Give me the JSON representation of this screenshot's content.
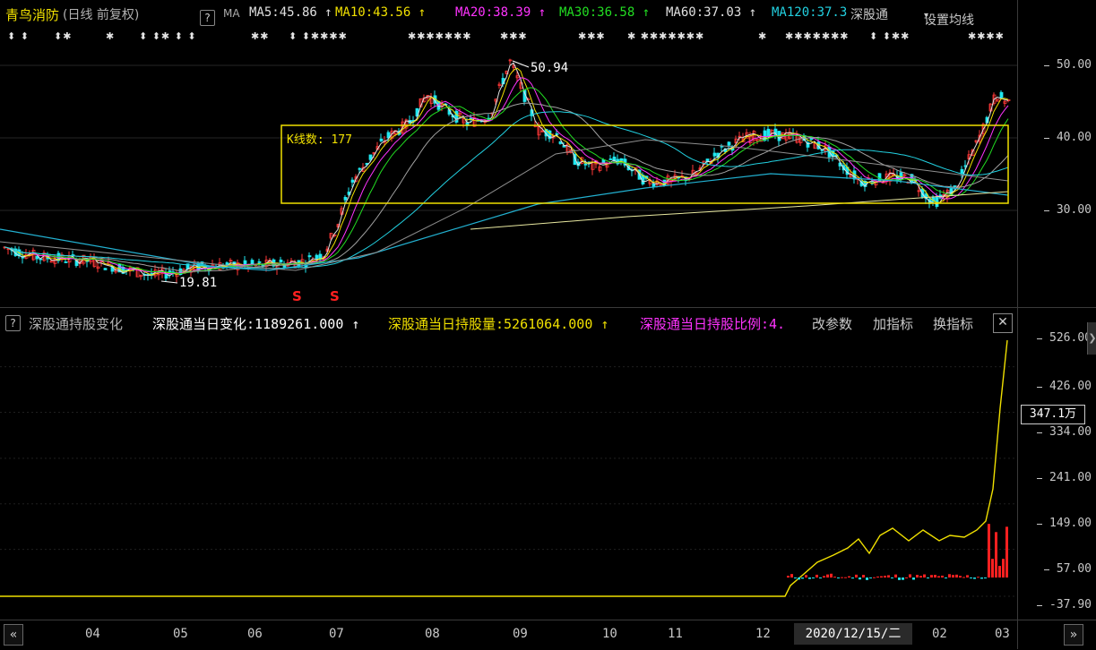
{
  "header": {
    "stock_name": "青鸟消防",
    "period_info": "(日线 前复权)",
    "help_glyph": "?",
    "ma_label": "MA",
    "ma_items": [
      {
        "text": "MA5:45.86",
        "arrow": "↑",
        "color": "#e0e0e0"
      },
      {
        "text": "MA10:43.56",
        "arrow": "↑",
        "color": "#f0e000"
      },
      {
        "text": "MA20:38.39",
        "arrow": "↑",
        "color": "#ff33ff"
      },
      {
        "text": "MA30:36.58",
        "arrow": "↑",
        "color": "#22dd22"
      },
      {
        "text": "MA60:37.03",
        "arrow": "↑",
        "color": "#e0e0e0"
      },
      {
        "text": "MA120:37.3",
        "arrow": "",
        "color": "#22d0e0"
      }
    ],
    "hk_connect": "深股通",
    "set_ma": "设置均线"
  },
  "markers": [
    {
      "text": "⬍ ⬍"
    },
    {
      "text": "⬍✱"
    },
    {
      "text": "✱"
    },
    {
      "text": "⬍ ⬍✱ ⬍ ⬍"
    },
    {
      "text": "✱✱"
    },
    {
      "text": "⬍ ⬍✱✱✱✱"
    },
    {
      "text": "✱✱✱✱✱✱✱"
    },
    {
      "text": "✱✱✱"
    },
    {
      "text": "✱✱✱"
    },
    {
      "text": "✱ ✱✱✱✱✱✱✱"
    },
    {
      "text": "✱"
    },
    {
      "text": "✱✱✱✱✱✱✱"
    },
    {
      "text": "⬍ ⬍✱✱"
    },
    {
      "text": "✱✱✱✱"
    }
  ],
  "price_chart": {
    "high_label": "50.94",
    "low_label": "19.81",
    "kline_count_label": "K线数: 177",
    "s_marker": "S",
    "y_ticks": [
      "50.00",
      "40.00",
      "30.00"
    ]
  },
  "indicator": {
    "help_glyph": "?",
    "name": "深股通持股变化",
    "items": [
      {
        "text": "深股通当日变化:1189261.000",
        "arrow": "↑",
        "color": "#ffffff"
      },
      {
        "text": "深股通当日持股量:5261064.000",
        "arrow": "↑",
        "color": "#f0e000"
      },
      {
        "text": "深股通当日持股比例:4.",
        "arrow": "",
        "color": "#ff33ff"
      }
    ],
    "edit_params": "改参数",
    "add_indicator": "加指标",
    "switch_indicator": "换指标",
    "close_glyph": "✕",
    "y_ticks": [
      "526.00",
      "426.00",
      "334.00",
      "241.00",
      "149.00",
      "57.00",
      "-37.90"
    ],
    "current_value": "347.1万"
  },
  "time_axis": {
    "months": [
      "04",
      "05",
      "06",
      "07",
      "08",
      "09",
      "10",
      "11",
      "12",
      "02",
      "03"
    ],
    "selected_date": "2020/12/15/二",
    "nav_left": "«",
    "nav_right": "»"
  },
  "colors": {
    "up_candle": "#ff3838",
    "down_candle": "#20e8f0",
    "band_box": "#f0e000",
    "holding_line": "#f0e000",
    "positive_bar": "#ff2020",
    "negative_bar": "#20e8f0"
  }
}
